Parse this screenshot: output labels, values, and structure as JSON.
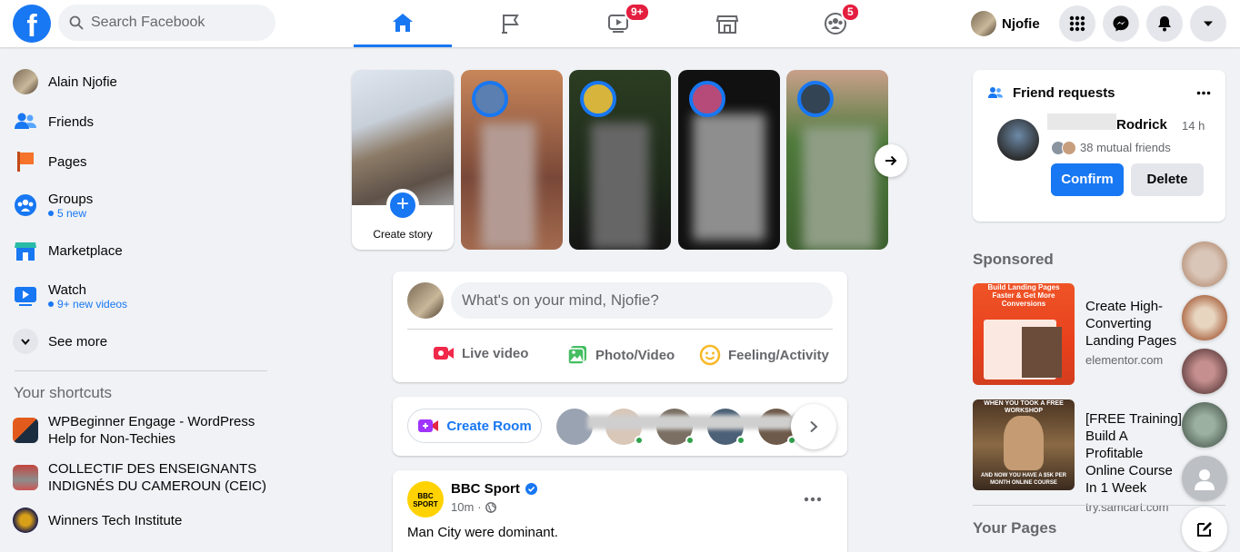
{
  "header": {
    "logo_letter": "f",
    "search_placeholder": "Search Facebook",
    "watch_badge": "9+",
    "groups_badge": "5",
    "profile_name": "Njofie"
  },
  "sidebar": {
    "items": [
      {
        "label": "Alain Njofie"
      },
      {
        "label": "Friends"
      },
      {
        "label": "Pages"
      },
      {
        "label": "Groups",
        "sub": "5 new"
      },
      {
        "label": "Marketplace"
      },
      {
        "label": "Watch",
        "sub": "9+ new videos"
      },
      {
        "label": "See more"
      }
    ],
    "shortcuts_title": "Your shortcuts",
    "shortcuts": [
      {
        "label": "WPBeginner Engage - WordPress Help for Non-Techies"
      },
      {
        "label": "COLLECTIF DES ENSEIGNANTS INDIGNÉS DU CAMEROUN (CEIC)"
      },
      {
        "label": "Winners Tech Institute"
      }
    ]
  },
  "stories": {
    "create_label": "Create story",
    "plus": "+"
  },
  "composer": {
    "placeholder": "What's on your mind, Njofie?",
    "actions": [
      {
        "label": "Live video",
        "color": "#f02849"
      },
      {
        "label": "Photo/Video",
        "color": "#45bd62"
      },
      {
        "label": "Feeling/Activity",
        "color": "#f7b928"
      }
    ]
  },
  "rooms": {
    "create_label": "Create Room"
  },
  "post": {
    "author": "BBC Sport",
    "logo_text": "BBC SPORT",
    "time": "10m",
    "text": "Man City were dominant."
  },
  "friend_requests": {
    "title": "Friend requests",
    "name": "Rodrick",
    "time": "14 h",
    "mutual": "38 mutual friends",
    "confirm": "Confirm",
    "delete": "Delete"
  },
  "sponsored": {
    "title": "Sponsored",
    "ads": [
      {
        "title": "Create High-Converting Landing Pages",
        "domain": "elementor.com",
        "image_text": "Build Landing Pages Faster & Get More Conversions"
      },
      {
        "title": "[FREE Training] Build A Profitable Online Course In 1 Week",
        "domain": "try.samcart.com",
        "image_text_top": "WHEN YOU TOOK A FREE WORKSHOP",
        "image_text_bottom": "AND NOW YOU HAVE A $5K PER MONTH ONLINE COURSE"
      }
    ]
  },
  "your_pages_title": "Your Pages",
  "colors": {
    "brand": "#1877f2",
    "badge": "#e41e3f",
    "background": "#f0f2f5"
  }
}
